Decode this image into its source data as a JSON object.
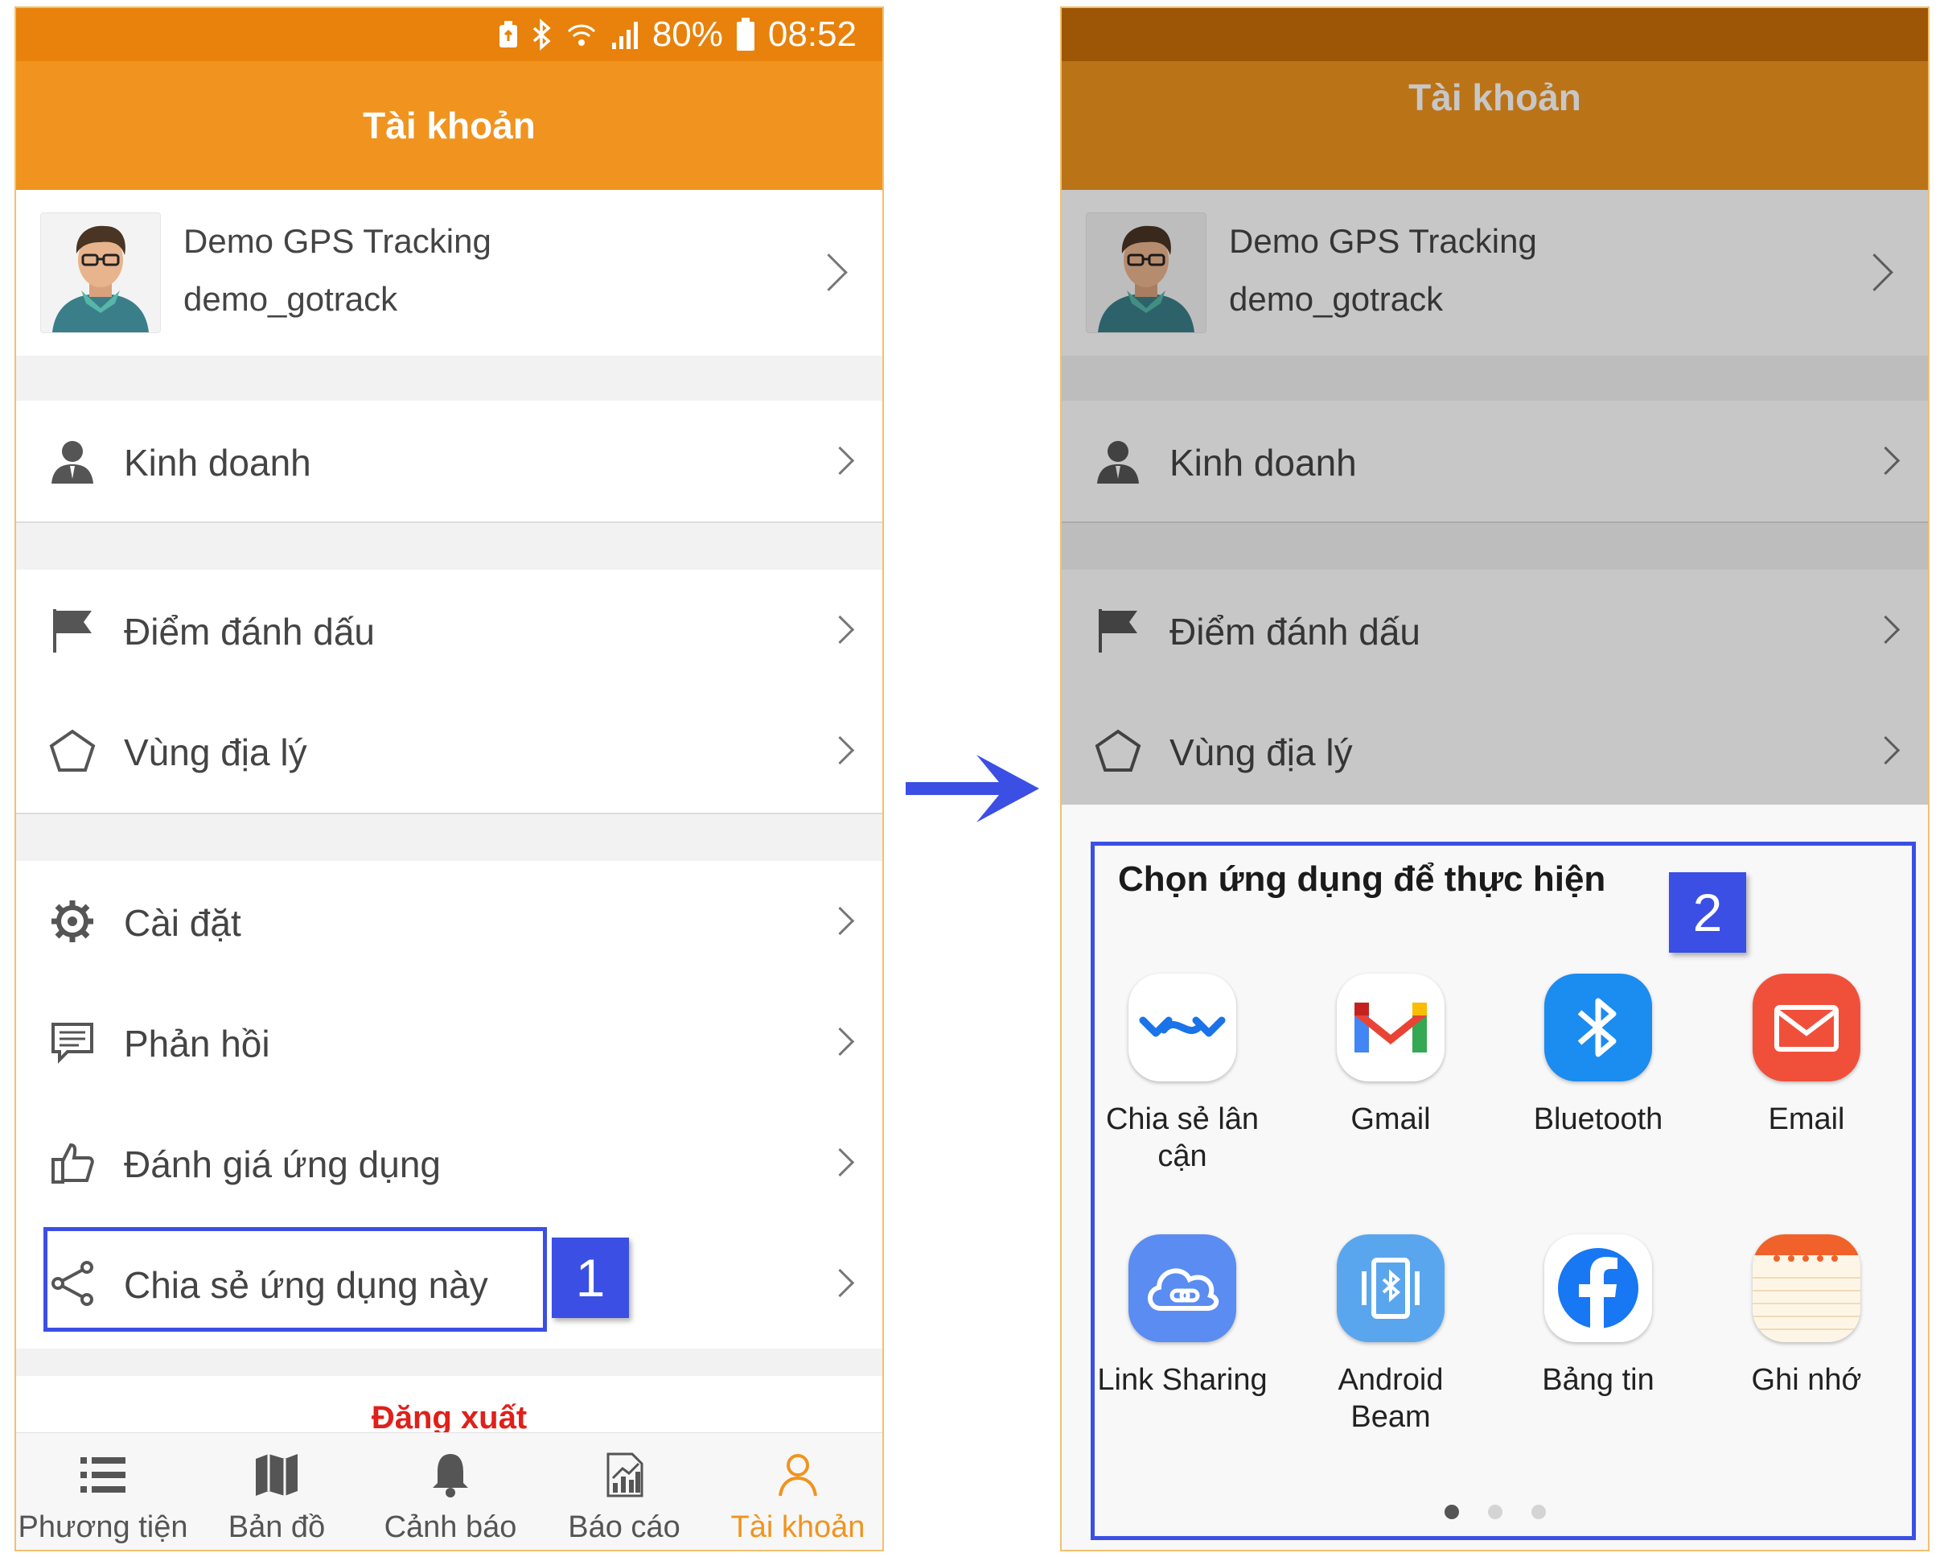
{
  "status": {
    "battery": "80%",
    "time": "08:52"
  },
  "header": {
    "title": "Tài khoản"
  },
  "profile": {
    "name": "Demo GPS Tracking",
    "username": "demo_gotrack"
  },
  "menu": {
    "business": "Kinh doanh",
    "markers": "Điểm đánh dấu",
    "geofence": "Vùng địa lý",
    "settings": "Cài đặt",
    "feedback": "Phản hồi",
    "rate": "Đánh giá ứng dụng",
    "share": "Chia sẻ ứng dụng này"
  },
  "logout": "Đăng xuất",
  "nav": [
    "Phương tiện",
    "Bản đồ",
    "Cảnh báo",
    "Báo cáo",
    "Tài khoản"
  ],
  "sheet": {
    "title": "Chọn ứng dụng để thực hiện",
    "apps": [
      {
        "label": "Chia sẻ lân cận",
        "icon": "nearby-share-icon"
      },
      {
        "label": "Gmail",
        "icon": "gmail-icon"
      },
      {
        "label": "Bluetooth",
        "icon": "bluetooth-icon"
      },
      {
        "label": "Email",
        "icon": "email-icon"
      },
      {
        "label": "Link Sharing",
        "icon": "link-sharing-icon"
      },
      {
        "label": "Android Beam",
        "icon": "android-beam-icon"
      },
      {
        "label": "Bảng tin",
        "icon": "facebook-icon"
      },
      {
        "label": "Ghi nhớ",
        "icon": "notes-icon"
      }
    ],
    "pages": 3
  },
  "annotations": {
    "step1": "1",
    "step2": "2"
  },
  "colors": {
    "orange": "#f0941f",
    "status": "#e8820c",
    "highlight": "#3b4fe4",
    "logout": "#e0201a"
  }
}
